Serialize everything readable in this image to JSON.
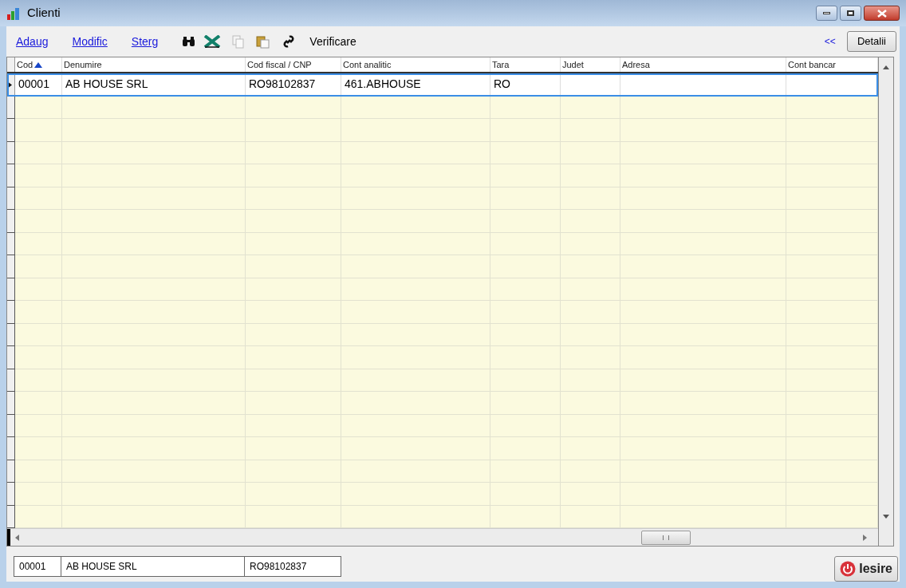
{
  "window": {
    "title": "Clienti"
  },
  "toolbar": {
    "links": [
      "Adaug",
      "Modific",
      "Sterg"
    ],
    "verify": "Verificare",
    "collapse": "<<",
    "details": "Detalii"
  },
  "table": {
    "columns": [
      {
        "label": "Cod",
        "sorted": true
      },
      {
        "label": "Denumire",
        "sorted": false
      },
      {
        "label": "Cod fiscal / CNP",
        "sorted": false
      },
      {
        "label": "Cont analitic",
        "sorted": false
      },
      {
        "label": "Tara",
        "sorted": false
      },
      {
        "label": "Judet",
        "sorted": false
      },
      {
        "label": "Adresa",
        "sorted": false
      },
      {
        "label": "Cont bancar",
        "sorted": false
      }
    ],
    "rows": [
      {
        "selected": true,
        "cells": [
          "00001",
          "AB HOUSE SRL",
          "RO98102837",
          "461.ABHOUSE",
          "RO",
          "",
          "",
          ""
        ]
      }
    ]
  },
  "summary": [
    "00001",
    "AB HOUSE SRL",
    "RO98102837"
  ],
  "exit_button": "Iesire"
}
